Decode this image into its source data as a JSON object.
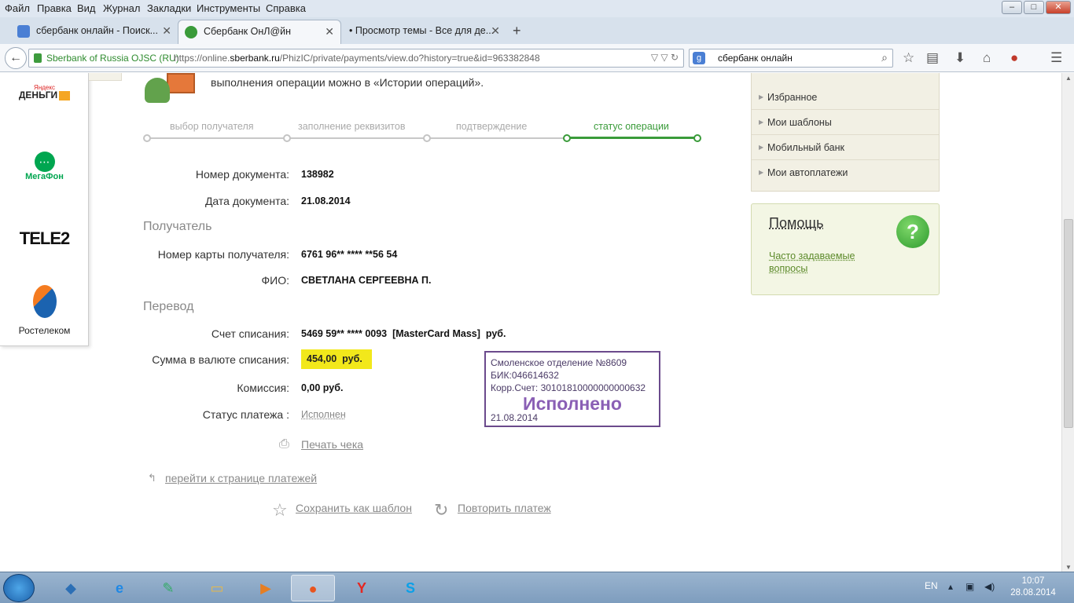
{
  "menubar": [
    "Файл",
    "Правка",
    "Вид",
    "Журнал",
    "Закладки",
    "Инструменты",
    "Справка"
  ],
  "window_controls": {
    "minimize": "–",
    "maximize": "□",
    "close": "✕"
  },
  "tabs": [
    {
      "label": "сбербанк онлайн - Поиск...",
      "icon": "google-icon",
      "active": false
    },
    {
      "label": "Сбербанк ОнЛ@йн",
      "icon": "sberbank-icon",
      "active": true
    },
    {
      "label": "• Просмотр темы - Все для де...",
      "icon": "",
      "active": false
    }
  ],
  "new_tab": "+",
  "nav": {
    "back": "←",
    "site_identity": "Sberbank of Russia OJSC (RU)",
    "url_prefix": "https://online.",
    "url_domain": "sberbank.ru",
    "url_rest": "/PhizIC/private/payments/view.do?history=true&id=963382848",
    "search_engine_icon": "g",
    "search_value": "сбербанк онлайн"
  },
  "left_logos": {
    "yandex_small": "Яндекс",
    "yandex": "ДЕНЬГИ",
    "megafon": "МегаФон",
    "tele2": "TELE2",
    "rostelecom": "Ростелеком"
  },
  "operation_text": "выполнения операции можно в «Истории операций».",
  "steps": [
    "выбор получателя",
    "заполнение реквизитов",
    "подтверждение",
    "статус операции"
  ],
  "document": {
    "number_label": "Номер документа:",
    "number": "138982",
    "date_label": "Дата документа:",
    "date": "21.08.2014"
  },
  "recipient": {
    "section": "Получатель",
    "card_label": "Номер карты получателя:",
    "card": "6761 96** **** **56 54",
    "name_label": "ФИО:",
    "name": "СВЕТЛАНА СЕРГЕЕВНА П."
  },
  "transfer": {
    "section": "Перевод",
    "account_label": "Счет списания:",
    "account": "5469 59** **** 0093  [MasterCard Mass]  руб.",
    "amount_label": "Сумма в валюте списания:",
    "amount": "454,00  руб.",
    "fee_label": "Комиссия:",
    "fee": "0,00 руб.",
    "status_label": "Статус платежа :",
    "status": "Исполнен"
  },
  "stamp": {
    "branch": "Смоленское отделение №8609",
    "bik": "БИК:046614632",
    "corr": "Корр.Счет: 30101810000000000632",
    "status": "Исполнено",
    "date": "21.08.2014"
  },
  "actions": {
    "print": "Печать чека",
    "back_to_payments": "перейти к странице платежей",
    "save_template": "Сохранить как шаблон",
    "repeat": "Повторить платеж"
  },
  "right_menu": [
    "Избранное",
    "Мои шаблоны",
    "Мобильный банк",
    "Мои автоплатежи"
  ],
  "help": {
    "title": "Помощь",
    "icon": "?",
    "link": "Часто задаваемые вопросы"
  },
  "taskbar": {
    "lang": "EN",
    "time": "10:07",
    "date": "28.08.2014"
  },
  "colors": {
    "accent_green": "#3a9b3a",
    "highlight_yellow": "#f2e81b",
    "stamp_purple": "#6b4a8c"
  }
}
